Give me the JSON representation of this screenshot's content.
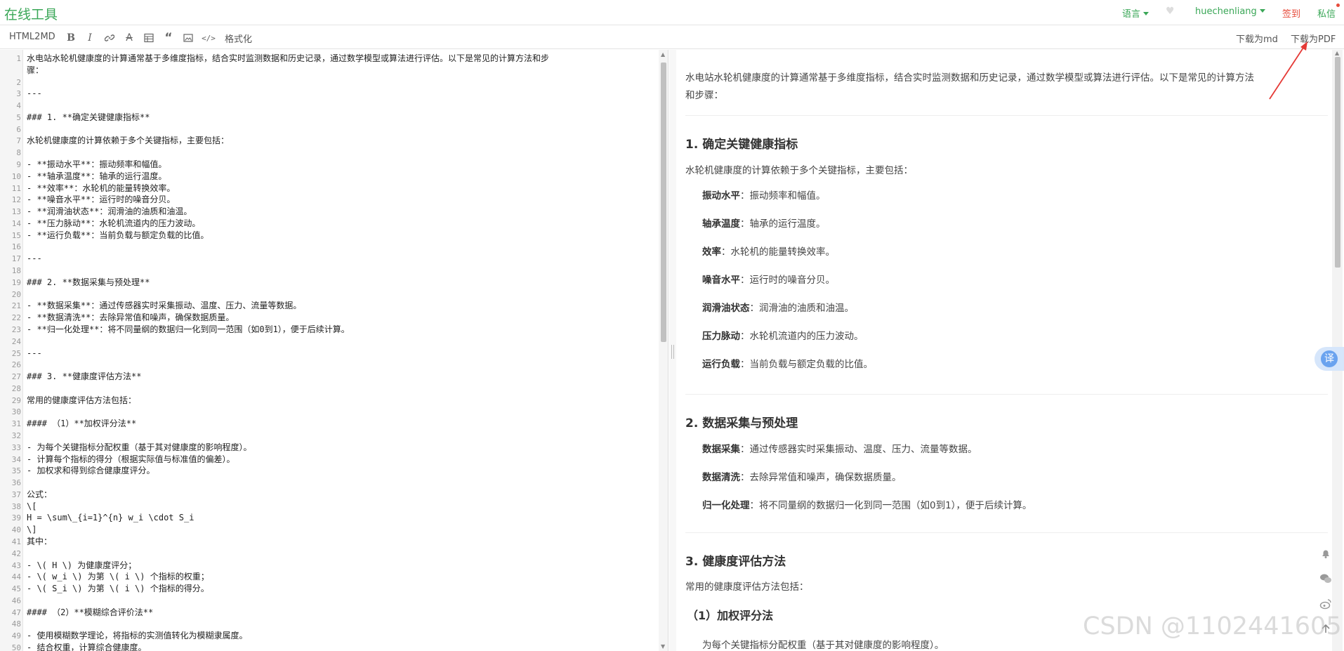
{
  "header": {
    "site_title": "在线工具",
    "language_label": "语言",
    "username": "huechenliang",
    "signin_label": "签到",
    "message_label": "私信",
    "colors": {
      "brand": "#3aa757",
      "signin": "#e74c3c"
    }
  },
  "toolbar": {
    "html2md_label": "HTML2MD",
    "format_label": "格式化",
    "download_md_label": "下载为md",
    "download_pdf_label": "下载为PDF",
    "icons": [
      "bold-icon",
      "italic-icon",
      "link-icon",
      "strikethrough-icon",
      "table-icon",
      "quote-icon",
      "image-icon",
      "code-icon"
    ]
  },
  "editor": {
    "lines": [
      {
        "n": "1",
        "t": "水电站水轮机健康度的计算通常基于多维度指标，结合实时监测数据和历史记录，通过数学模型或算法进行评估。以下是常见的计算方法和步"
      },
      {
        "n": "",
        "t": "骤："
      },
      {
        "n": "2",
        "t": ""
      },
      {
        "n": "3",
        "t": "---"
      },
      {
        "n": "4",
        "t": ""
      },
      {
        "n": "5",
        "t": "### 1. **确定关键健康指标**"
      },
      {
        "n": "6",
        "t": ""
      },
      {
        "n": "7",
        "t": "水轮机健康度的计算依赖于多个关键指标，主要包括："
      },
      {
        "n": "8",
        "t": ""
      },
      {
        "n": "9",
        "t": "- **振动水平**：振动频率和幅值。"
      },
      {
        "n": "10",
        "t": "- **轴承温度**：轴承的运行温度。"
      },
      {
        "n": "11",
        "t": "- **效率**：水轮机的能量转换效率。"
      },
      {
        "n": "12",
        "t": "- **噪音水平**：运行时的噪音分贝。"
      },
      {
        "n": "13",
        "t": "- **润滑油状态**：润滑油的油质和油温。"
      },
      {
        "n": "14",
        "t": "- **压力脉动**：水轮机流道内的压力波动。"
      },
      {
        "n": "15",
        "t": "- **运行负载**：当前负载与额定负载的比值。"
      },
      {
        "n": "16",
        "t": ""
      },
      {
        "n": "17",
        "t": "---"
      },
      {
        "n": "18",
        "t": ""
      },
      {
        "n": "19",
        "t": "### 2. **数据采集与预处理**"
      },
      {
        "n": "20",
        "t": ""
      },
      {
        "n": "21",
        "t": "- **数据采集**：通过传感器实时采集振动、温度、压力、流量等数据。"
      },
      {
        "n": "22",
        "t": "- **数据清洗**：去除异常值和噪声，确保数据质量。"
      },
      {
        "n": "23",
        "t": "- **归一化处理**：将不同量纲的数据归一化到同一范围（如0到1），便于后续计算。"
      },
      {
        "n": "24",
        "t": ""
      },
      {
        "n": "25",
        "t": "---"
      },
      {
        "n": "26",
        "t": ""
      },
      {
        "n": "27",
        "t": "### 3. **健康度评估方法**"
      },
      {
        "n": "28",
        "t": ""
      },
      {
        "n": "29",
        "t": "常用的健康度评估方法包括："
      },
      {
        "n": "30",
        "t": ""
      },
      {
        "n": "31",
        "t": "#### （1）**加权评分法**"
      },
      {
        "n": "32",
        "t": ""
      },
      {
        "n": "33",
        "t": "- 为每个关键指标分配权重（基于其对健康度的影响程度）。"
      },
      {
        "n": "34",
        "t": "- 计算每个指标的得分（根据实际值与标准值的偏差）。"
      },
      {
        "n": "35",
        "t": "- 加权求和得到综合健康度评分。"
      },
      {
        "n": "36",
        "t": ""
      },
      {
        "n": "37",
        "t": "公式："
      },
      {
        "n": "38",
        "t": "\\["
      },
      {
        "n": "39",
        "t": "H = \\sum\\_{i=1}^{n} w_i \\cdot S_i"
      },
      {
        "n": "40",
        "t": "\\]"
      },
      {
        "n": "41",
        "t": "其中："
      },
      {
        "n": "42",
        "t": ""
      },
      {
        "n": "43",
        "t": "- \\( H \\) 为健康度评分；"
      },
      {
        "n": "44",
        "t": "- \\( w_i \\) 为第 \\( i \\) 个指标的权重；"
      },
      {
        "n": "45",
        "t": "- \\( S_i \\) 为第 \\( i \\) 个指标的得分。"
      },
      {
        "n": "46",
        "t": ""
      },
      {
        "n": "47",
        "t": "#### （2）**模糊综合评价法**"
      },
      {
        "n": "48",
        "t": ""
      },
      {
        "n": "49",
        "t": "- 使用模糊数学理论，将指标的实测值转化为模糊隶属度。"
      },
      {
        "n": "50",
        "t": "- 结合权重，计算综合健康度。"
      }
    ]
  },
  "preview": {
    "intro_line1": "水电站水轮机健康度的计算通常基于多维度指标，结合实时监测数据和历史记录，通过数学模型或算法进行评估。以下是常见的计算方法",
    "intro_line2": "和步骤：",
    "h1": "1. 确定关键健康指标",
    "h1_text": "水轮机健康度的计算依赖于多个关键指标，主要包括：",
    "metrics": [
      {
        "k": "振动水平",
        "v": "：振动频率和幅值。"
      },
      {
        "k": "轴承温度",
        "v": "：轴承的运行温度。"
      },
      {
        "k": "效率",
        "v": "：水轮机的能量转换效率。"
      },
      {
        "k": "噪音水平",
        "v": "：运行时的噪音分贝。"
      },
      {
        "k": "润滑油状态",
        "v": "：润滑油的油质和油温。"
      },
      {
        "k": "压力脉动",
        "v": "：水轮机流道内的压力波动。"
      },
      {
        "k": "运行负载",
        "v": "：当前负载与额定负载的比值。"
      }
    ],
    "h2": "2. 数据采集与预处理",
    "data_items": [
      {
        "k": "数据采集",
        "v": "：通过传感器实时采集振动、温度、压力、流量等数据。"
      },
      {
        "k": "数据清洗",
        "v": "：去除异常值和噪声，确保数据质量。"
      },
      {
        "k": "归一化处理",
        "v": "：将不同量纲的数据归一化到同一范围（如0到1），便于后续计算。"
      }
    ],
    "h3": "3. 健康度评估方法",
    "h3_text": "常用的健康度评估方法包括：",
    "h4": "（1）加权评分法",
    "last_line": "为每个关键指标分配权重（基于其对健康度的影响程度）。"
  },
  "side": {
    "translate_label": "译"
  },
  "watermark": "CSDN @1102441605"
}
